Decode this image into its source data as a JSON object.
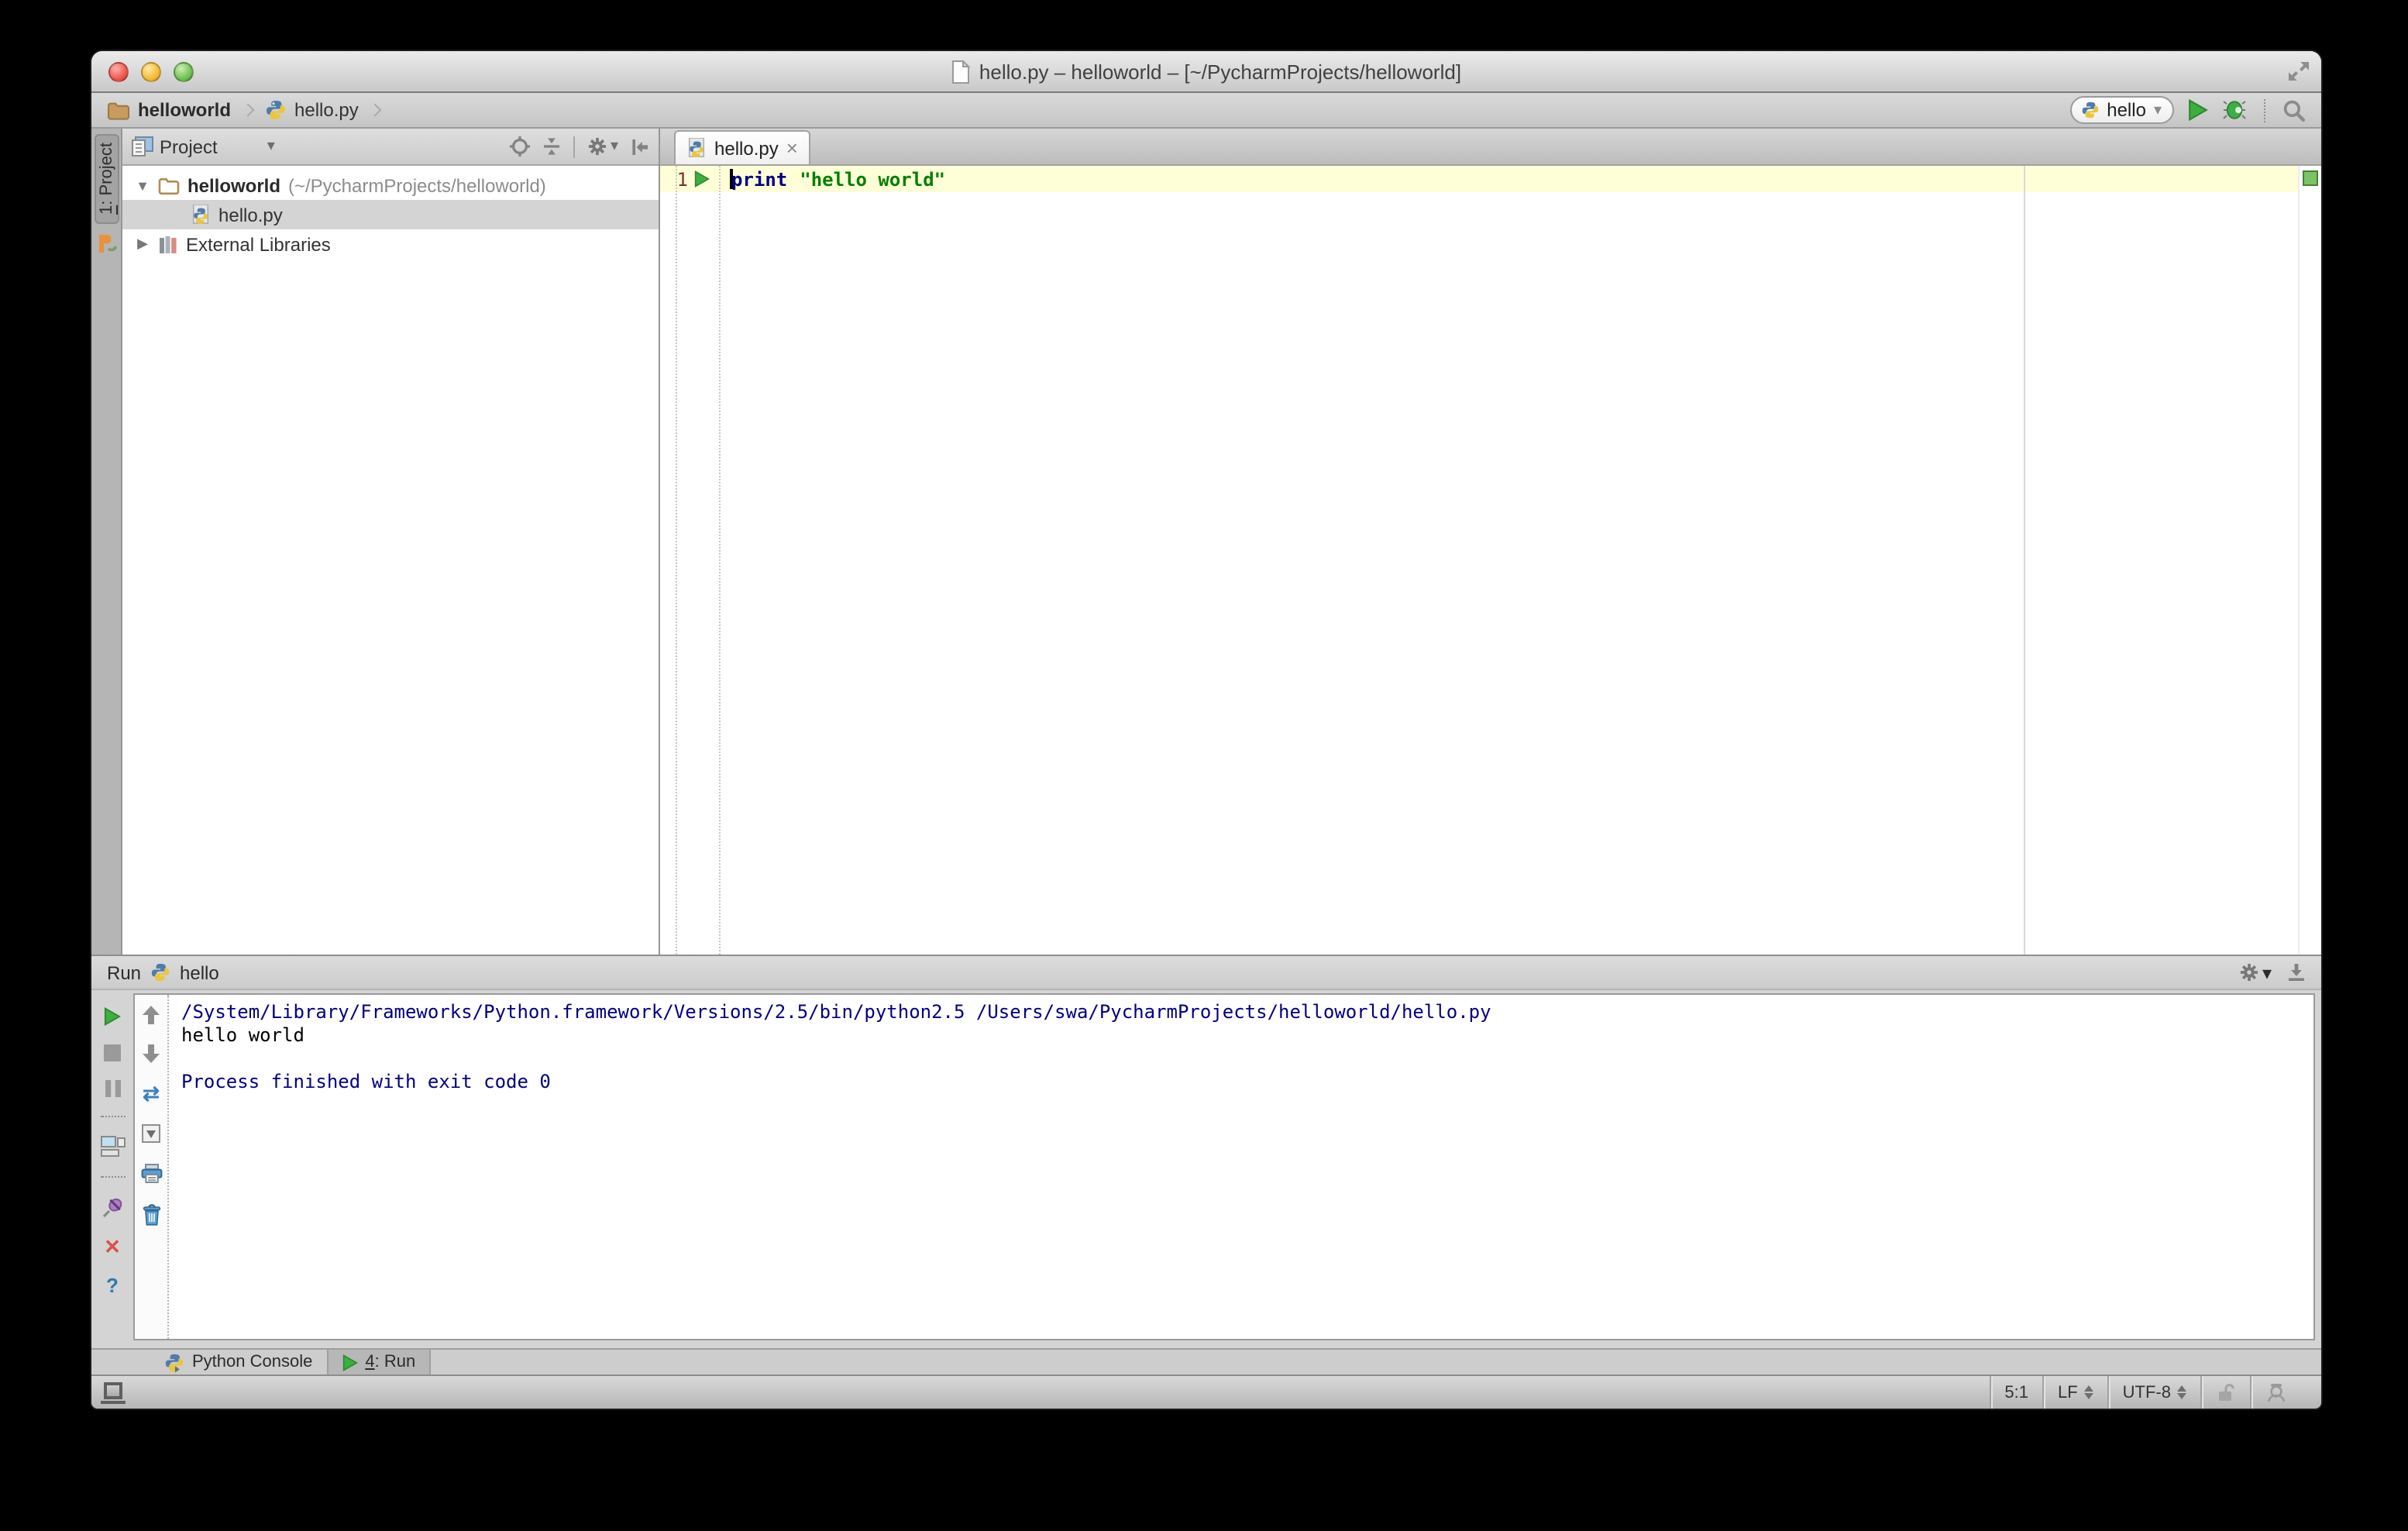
{
  "window": {
    "title": "hello.py – helloworld – [~/PycharmProjects/helloworld]"
  },
  "toolbar": {
    "breadcrumbs": [
      {
        "label": "helloworld"
      },
      {
        "label": "hello.py"
      }
    ],
    "run_config": {
      "name": "hello"
    }
  },
  "stripe": {
    "project_tab": {
      "number": "1",
      "rest": ": Project"
    }
  },
  "project_panel": {
    "title": "Project",
    "tree": {
      "root": {
        "name": "helloworld",
        "path": "(~/PycharmProjects/helloworld)"
      },
      "file": {
        "name": "hello.py"
      },
      "libraries": {
        "name": "External Libraries"
      }
    }
  },
  "editor": {
    "tab": {
      "title": "hello.py"
    },
    "line_number": "1",
    "code": {
      "keyword": "print",
      "string": "\"hello world\""
    }
  },
  "run_panel": {
    "title": "Run",
    "config_name": "hello",
    "console": {
      "line1": "/System/Library/Frameworks/Python.framework/Versions/2.5/bin/python2.5 /Users/swa/PycharmProjects/helloworld/hello.py",
      "line2": "hello world",
      "line4": "Process finished with exit code 0"
    }
  },
  "bottom_bar": {
    "tabs": [
      {
        "label": "Python Console"
      },
      {
        "number": "4",
        "rest": ": Run"
      }
    ]
  },
  "status_bar": {
    "caret_position": "5:1",
    "line_separator": "LF",
    "encoding": "UTF-8"
  },
  "icons": {
    "combo_arrow": "▾",
    "tree_expanded": "▼",
    "tree_collapsed": "▶",
    "close_tab": "×",
    "close": "✕",
    "help": "?",
    "soft_wrap": "⇄"
  },
  "colors": {
    "keyword": "#000080",
    "string": "#008000",
    "console_info": "#000080",
    "console_text": "#000000",
    "current_line": "#FFFFD7",
    "run_green": "#3EAE3F",
    "inspection_ok": "#7AC465",
    "selection_gray": "#D4D4D4"
  }
}
